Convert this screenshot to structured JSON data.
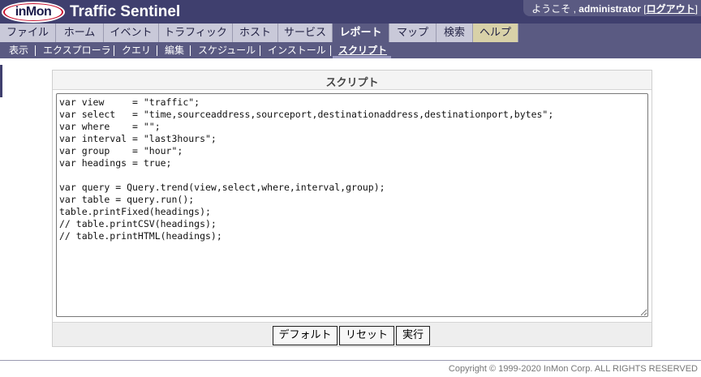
{
  "header": {
    "logo_text": "inMon",
    "app_title": "Traffic Sentinel",
    "welcome": "ようこそ , ",
    "username": "administrator",
    "logout_open": " [",
    "logout": "ログアウト",
    "logout_close": "]"
  },
  "main_nav": [
    {
      "label": "ファイル"
    },
    {
      "label": "ホーム"
    },
    {
      "label": "イベント"
    },
    {
      "label": "トラフィック"
    },
    {
      "label": "ホスト"
    },
    {
      "label": "サービス"
    },
    {
      "label": "レポート",
      "active": true
    },
    {
      "label": "マップ"
    },
    {
      "label": "検索"
    },
    {
      "label": "ヘルプ"
    }
  ],
  "sub_nav": [
    {
      "label": "表示"
    },
    {
      "label": "エクスプローラ"
    },
    {
      "label": "クエリ"
    },
    {
      "label": "編集"
    },
    {
      "label": "スケジュール"
    },
    {
      "label": "インストール"
    },
    {
      "label": "スクリプト",
      "active": true
    }
  ],
  "panel": {
    "title": "スクリプト",
    "script": "var view     = \"traffic\";\nvar select   = \"time,sourceaddress,sourceport,destinationaddress,destinationport,bytes\";\nvar where    = \"\";\nvar interval = \"last3hours\";\nvar group    = \"hour\";\nvar headings = true;\n\nvar query = Query.trend(view,select,where,interval,group);\nvar table = query.run();\ntable.printFixed(headings);\n// table.printCSV(headings);\n// table.printHTML(headings);"
  },
  "buttons": {
    "default": "デフォルト",
    "reset": "リセット",
    "run": "実行"
  },
  "footer": {
    "copyright": "Copyright © 1999-2020 InMon Corp. ALL RIGHTS RESERVED"
  },
  "colors": {
    "header_bg": "#3f3f6e",
    "nav_bg": "#5a5a82",
    "tab_bg": "#c9c9d9",
    "help_tab_bg": "#d8d1a8",
    "logo_red": "#c8102e"
  }
}
